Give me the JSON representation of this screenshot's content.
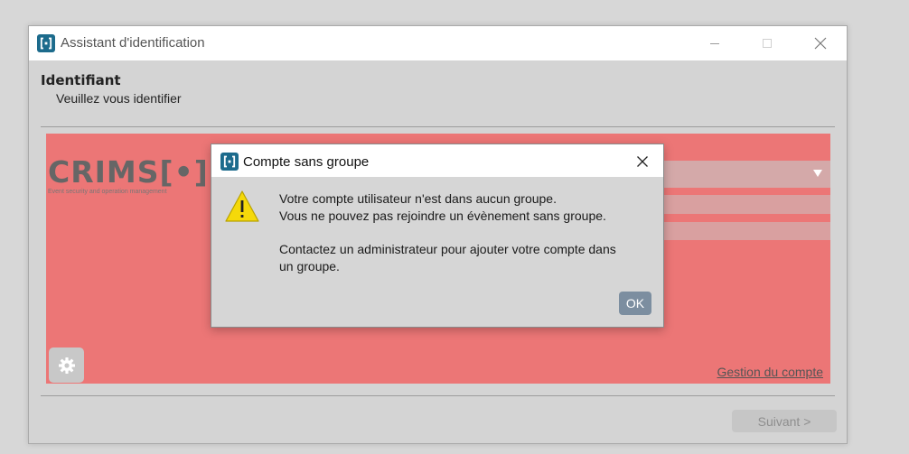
{
  "window": {
    "title": "Assistant d'identification",
    "header_title": "Identifiant",
    "header_subtitle": "Veuillez vous identifier"
  },
  "panel": {
    "logo_text": "CRIMS[•]N",
    "logo_tagline": "Event security and operation management",
    "account_link": "Gestion du compte"
  },
  "footer": {
    "next_label": "Suivant >"
  },
  "dialog": {
    "title": "Compte sans groupe",
    "message_line1": "Votre compte utilisateur n'est dans aucun groupe.",
    "message_line2": "Vous ne pouvez pas rejoindre un évènement sans groupe.",
    "message_line3": "Contactez un administrateur pour ajouter votre compte dans",
    "message_line4": "un groupe.",
    "ok_label": "OK"
  },
  "colors": {
    "accent": "#1c6b8c",
    "panel_bg": "#ec7676",
    "ok_button": "#7c8ea0",
    "warning_yellow": "#f5d90a"
  },
  "icons": {
    "app": "crimson-app-icon",
    "warning": "warning-triangle-icon",
    "settings": "gear-icon",
    "dropdown": "chevron-down-icon"
  }
}
